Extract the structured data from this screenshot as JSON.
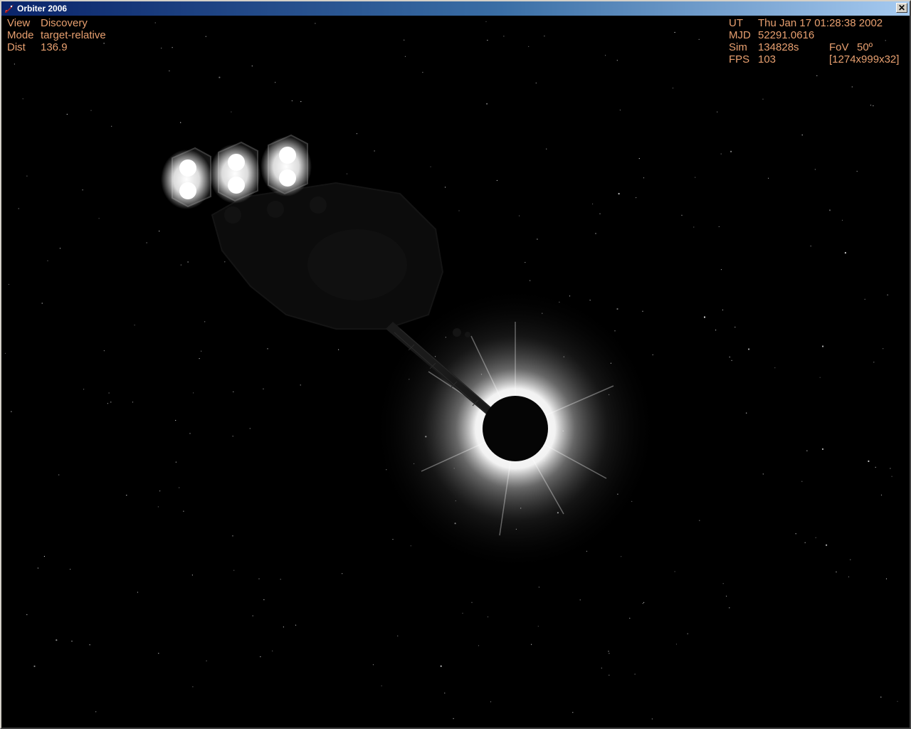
{
  "window": {
    "title": "Orbiter 2006",
    "close_glyph": "✕",
    "icons": {
      "app": "orbiter-rocket-icon",
      "close": "close-icon"
    }
  },
  "hud": {
    "color": "#e8a070",
    "left": {
      "view_label": "View",
      "view_value": "Discovery",
      "mode_label": "Mode",
      "mode_value": "target-relative",
      "dist_label": "Dist",
      "dist_value": "136.9"
    },
    "right": {
      "ut_label": "UT",
      "ut_value": "Thu Jan 17 01:28:38 2002",
      "mjd_label": "MJD",
      "mjd_value": "52291.0616",
      "sim_label": "Sim",
      "sim_value": "134828s",
      "fov_label": "FoV",
      "fov_value": "50º",
      "fps_label": "FPS",
      "fps_value": "103",
      "resolution_value": "[1274x999x32]"
    }
  },
  "colors": {
    "titlebar_start": "#0a246a",
    "titlebar_end": "#a6caf0",
    "space": "#000000"
  }
}
